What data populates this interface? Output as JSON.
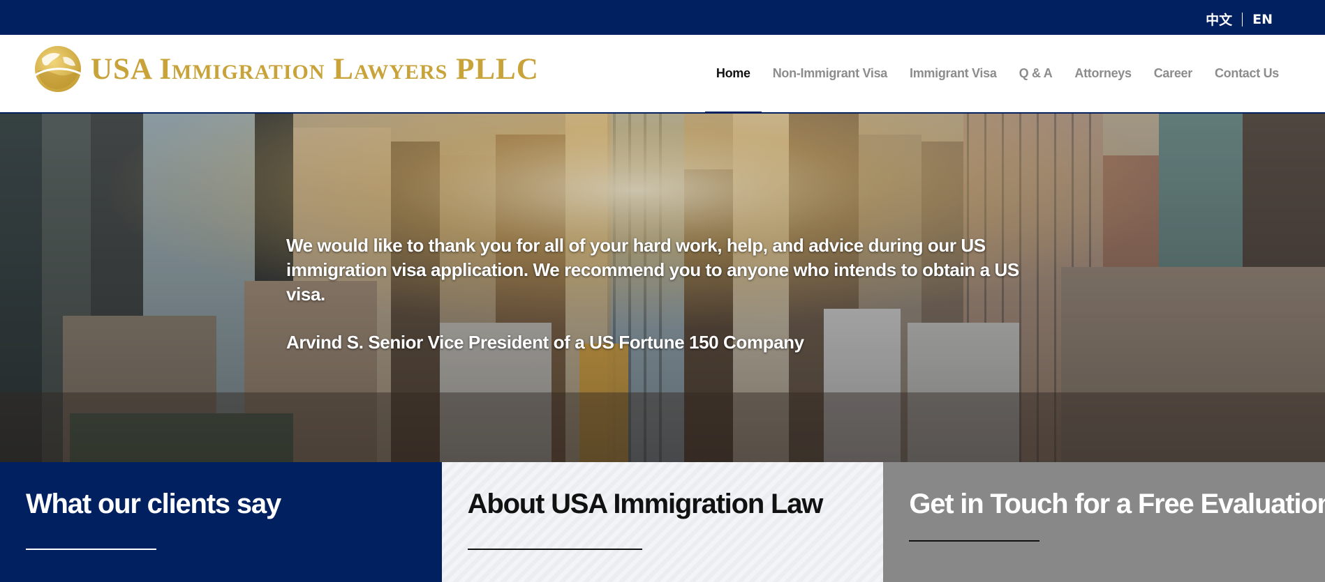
{
  "topbar": {
    "lang_zh": "中文",
    "lang_en": "EN"
  },
  "header": {
    "logo_text": "USA Immigration Lawyers PLLC",
    "nav": [
      {
        "label": "Home",
        "active": true
      },
      {
        "label": "Non-Immigrant Visa",
        "active": false
      },
      {
        "label": "Immigrant Visa",
        "active": false
      },
      {
        "label": "Q & A",
        "active": false
      },
      {
        "label": "Attorneys",
        "active": false
      },
      {
        "label": "Career",
        "active": false
      },
      {
        "label": "Contact Us",
        "active": false
      }
    ]
  },
  "hero": {
    "quote": "We would like to thank you for all of your hard work, help, and advice during our US immigration visa application. We recommend you to anyone who intends to obtain a US visa.",
    "author": "Arvind S. Senior Vice President of a US Fortune 150 Company"
  },
  "panels": [
    {
      "title": "What our clients say"
    },
    {
      "title": "About USA Immigration Law"
    },
    {
      "title": "Get in Touch for a Free Evaluation"
    }
  ],
  "colors": {
    "brand_navy": "#00205f",
    "logo_gold": "#c8a33a",
    "nav_inactive": "#8c8c8c",
    "panel_gray": "#888888"
  },
  "icons": {
    "logo": "globe-logo-icon"
  }
}
